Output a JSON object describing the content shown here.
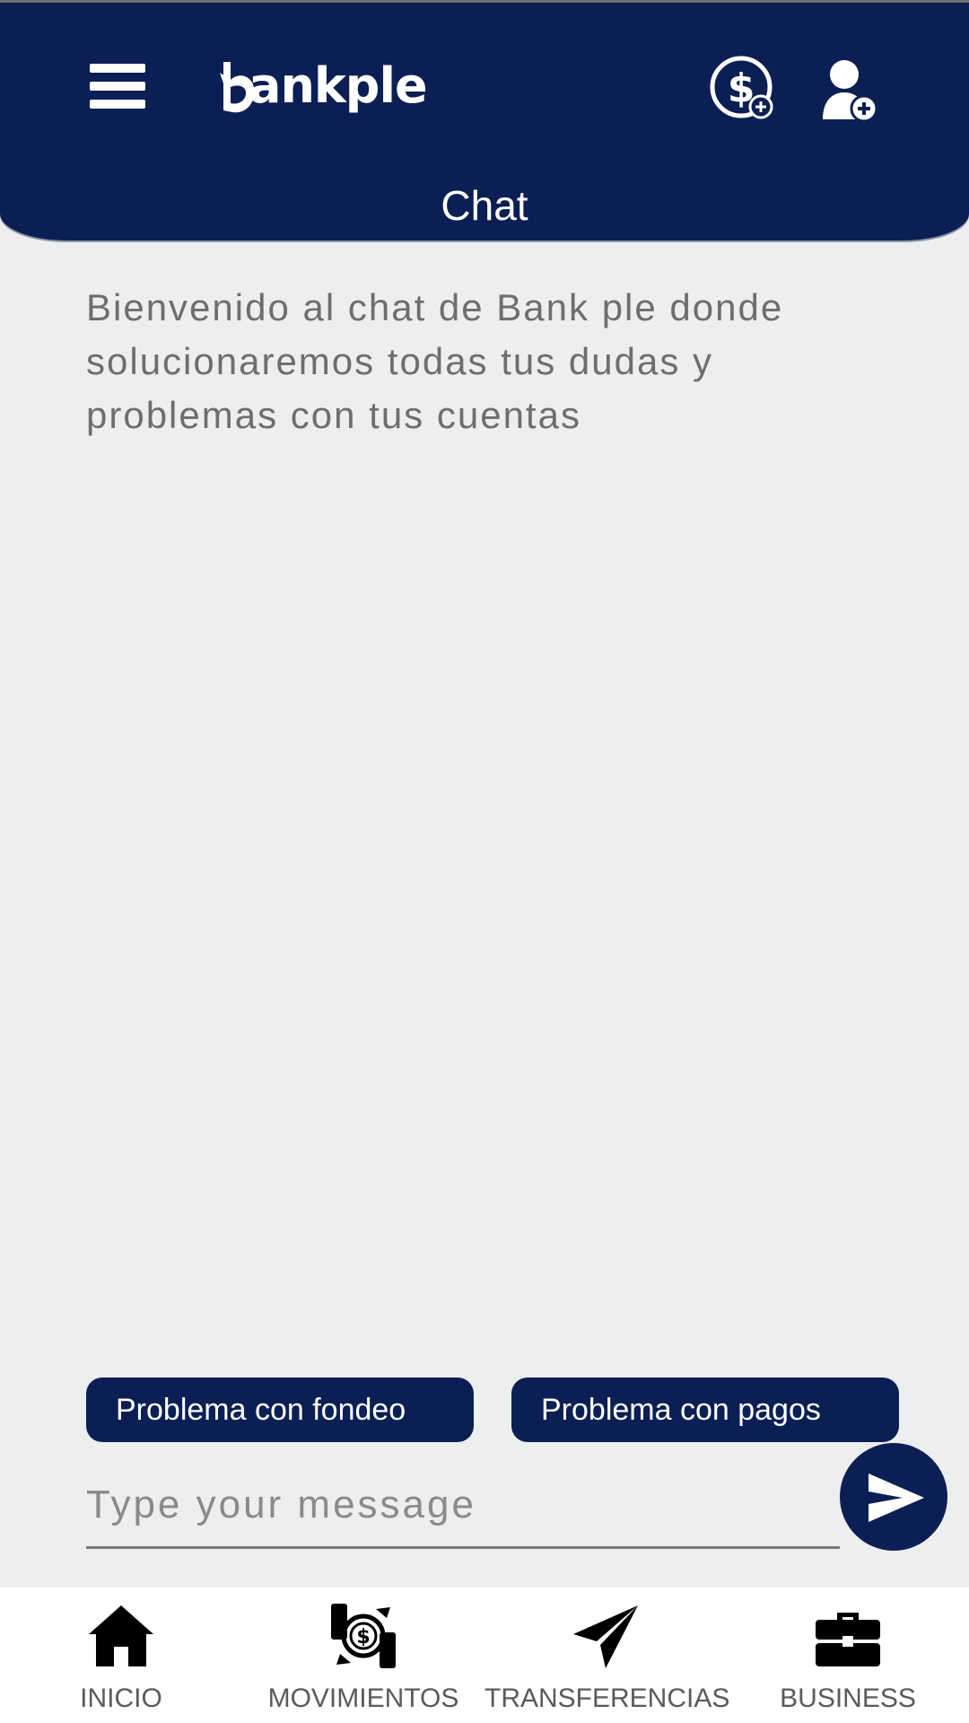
{
  "header": {
    "logo_text": "ankple",
    "title": "Chat",
    "icons": [
      "menu-icon",
      "dollar-add-icon",
      "user-add-icon"
    ]
  },
  "chat": {
    "welcome_message": "Bienvenido al chat de Bank ple donde solucionaremos todas tus dudas y problemas con tus cuentas"
  },
  "quick_replies": [
    {
      "label": "Problema con fondeo"
    },
    {
      "label": "Problema con pagos"
    }
  ],
  "composer": {
    "placeholder": "Type your message",
    "value": "",
    "send_icon": "send-icon"
  },
  "bottom_nav": {
    "items": [
      {
        "label": "INICIO",
        "icon": "home-icon"
      },
      {
        "label": "MOVIMIENTOS",
        "icon": "money-exchange-icon"
      },
      {
        "label": "TRANSFERENCIAS",
        "icon": "paper-plane-icon"
      },
      {
        "label": "BUSINESS",
        "icon": "briefcase-icon"
      }
    ]
  },
  "colors": {
    "brand_navy": "#0c1f55",
    "background": "#edeef0",
    "text_muted": "#6e6e6e"
  }
}
